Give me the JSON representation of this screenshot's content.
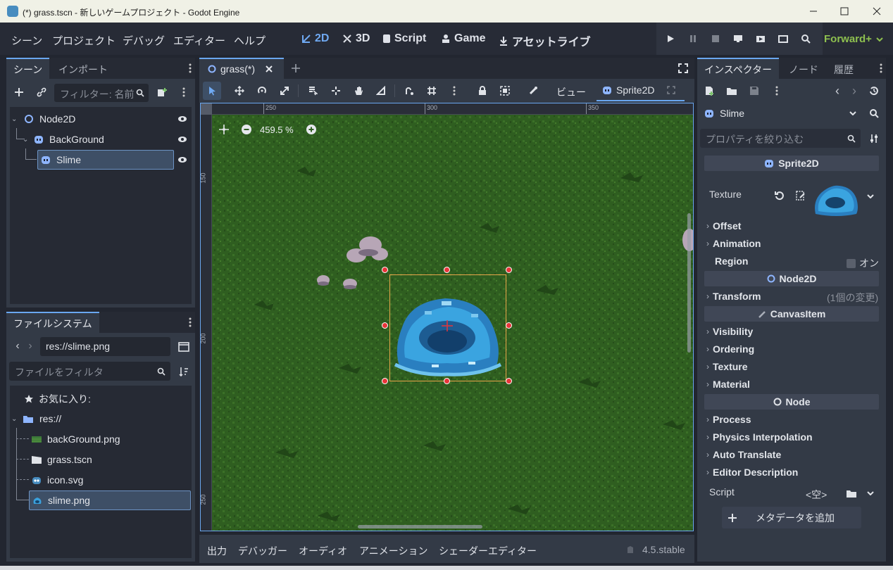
{
  "window": {
    "title": "(*) grass.tscn - 新しいゲームプロジェクト - Godot Engine"
  },
  "menu": [
    "シーン",
    "プロジェクト",
    "デバッグ",
    "エディター",
    "ヘルプ"
  ],
  "modes": [
    "2D",
    "3D",
    "Script",
    "Game",
    "アセットライブ"
  ],
  "renderer": "Forward+",
  "scene_dock": {
    "tabs": [
      "シーン",
      "インポート"
    ],
    "filter_placeholder": "フィルター: 名前",
    "nodes": [
      "Node2D",
      "BackGround",
      "Slime"
    ]
  },
  "filesystem": {
    "tab": "ファイルシステム",
    "path": "res://slime.png",
    "filter_placeholder": "ファイルをフィルタ",
    "favorites": "お気に入り:",
    "root": "res://",
    "files": [
      "backGround.png",
      "grass.tscn",
      "icon.svg",
      "slime.png"
    ]
  },
  "editor": {
    "tab": "grass(*)",
    "view_label": "ビュー",
    "selected_node": "Sprite2D",
    "zoom": "459.5 %",
    "ruler_top": [
      "250",
      "300",
      "350"
    ],
    "ruler_left": [
      "150",
      "200",
      "250"
    ]
  },
  "bottom": {
    "tabs": [
      "出力",
      "デバッガー",
      "オーディオ",
      "アニメーション",
      "シェーダーエディター"
    ],
    "version": "4.5.stable"
  },
  "inspector": {
    "tabs": [
      "インスペクター",
      "ノード",
      "履歴"
    ],
    "object": "Slime",
    "filter_placeholder": "プロパティを絞り込む",
    "class": "Sprite2D",
    "texture_label": "Texture",
    "sprite_props": [
      "Offset",
      "Animation"
    ],
    "region_label": "Region",
    "region_value": "オン",
    "node2d_section": "Node2D",
    "transform_label": "Transform",
    "transform_note": "(1個の変更)",
    "canvas_section": "CanvasItem",
    "canvas_props": [
      "Visibility",
      "Ordering",
      "Texture",
      "Material"
    ],
    "node_section": "Node",
    "node_props": [
      "Process",
      "Physics Interpolation",
      "Auto Translate",
      "Editor Description"
    ],
    "script_label": "Script",
    "script_value": "<空>",
    "add_meta": "メタデータを追加"
  },
  "colors": {
    "accent": "#6aa7f0",
    "renderer": "#8ec04f",
    "selection_box": "#e8a64a",
    "handle": "#e8353a"
  }
}
